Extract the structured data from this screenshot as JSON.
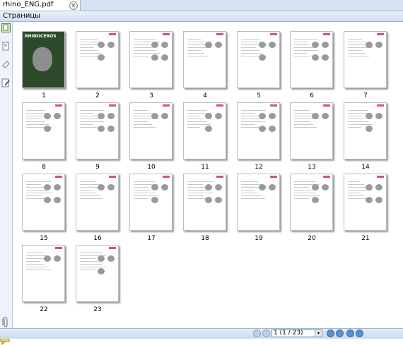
{
  "tab": {
    "title": "rhino_ENG.pdf",
    "close": "×"
  },
  "panel": {
    "title": "Страницы"
  },
  "cover": {
    "title": "RHINOCEROS"
  },
  "pages": [
    "1",
    "2",
    "3",
    "4",
    "5",
    "6",
    "7",
    "8",
    "9",
    "10",
    "11",
    "12",
    "13",
    "14",
    "15",
    "16",
    "17",
    "18",
    "19",
    "20",
    "21",
    "22",
    "23"
  ],
  "status": {
    "page_indicator": "1 (1 / 23)",
    "dropdown": "▾"
  },
  "sidebar": {
    "icons": [
      "pages-panel-icon",
      "bookmarks-icon",
      "attachments-icon",
      "signatures-icon"
    ]
  },
  "colors": {
    "brand_pink": "#d04f8b",
    "cover_green": "#2c4a2a"
  }
}
